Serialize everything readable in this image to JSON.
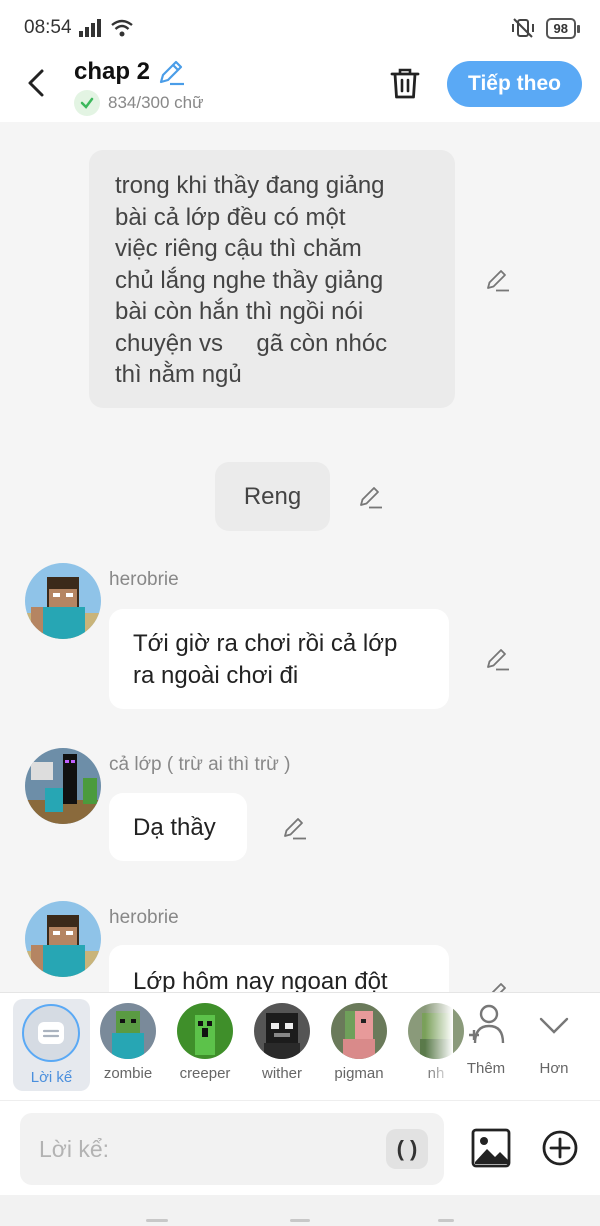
{
  "status_bar": {
    "time": "08:54",
    "battery": "98"
  },
  "header": {
    "title": "chap 2",
    "word_count": "834/300 chữ",
    "next_label": "Tiếp theo"
  },
  "messages": {
    "narration1": [
      "trong khi thầy đang giảng",
      "bài cả lớp đều có một",
      "việc riêng cậu thì chăm",
      "chủ lắng nghe thầy giảng",
      "bài còn hắn thì ngồi nói",
      "chuyện vs     gã còn nhóc",
      "thì nằm ngủ"
    ],
    "narration2": "Reng",
    "msg1": {
      "speaker": "herobrie",
      "lines": [
        "Tới giờ ra chơi rồi cả lớp",
        "ra ngoài chơi đi"
      ]
    },
    "msg2": {
      "speaker": "cả lớp ( trừ ai thì trừ )",
      "text": "Dạ thầy"
    },
    "msg3": {
      "speaker": "herobrie",
      "text": "Lớp hôm nay ngoan đột"
    }
  },
  "characters": {
    "narrator": "Lời kể",
    "items": [
      "zombie",
      "creeper",
      "wither",
      "pigman",
      "nh"
    ],
    "more_label": "Thêm",
    "collapse_label": "Hơn"
  },
  "input": {
    "placeholder": "Lời kể:",
    "paren": "( )"
  },
  "colors": {
    "accent": "#5aa9f5",
    "background": "#f5f5f5",
    "narration_bg": "#ebebeb"
  }
}
